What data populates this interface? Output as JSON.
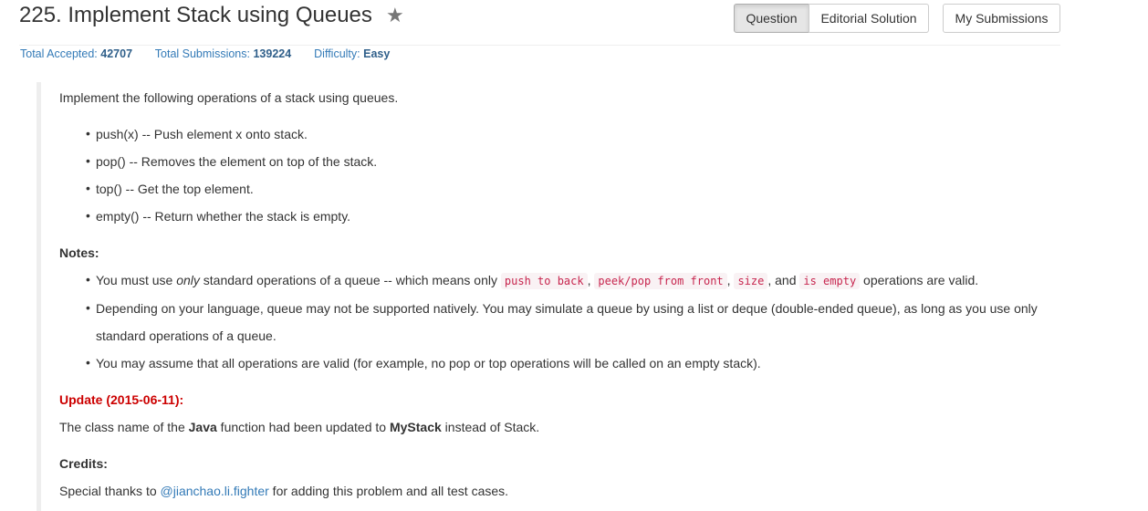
{
  "problem": {
    "title": "225. Implement Stack using Queues",
    "star_icon": "star-icon"
  },
  "tabs": {
    "question": "Question",
    "editorial": "Editorial Solution",
    "submissions": "My Submissions"
  },
  "stats": {
    "accepted_label": "Total Accepted:",
    "accepted_value": "42707",
    "submissions_label": "Total Submissions:",
    "submissions_value": "139224",
    "difficulty_label": "Difficulty:",
    "difficulty_value": "Easy"
  },
  "description": {
    "intro": "Implement the following operations of a stack using queues.",
    "operations": [
      "push(x) -- Push element x onto stack.",
      "pop() -- Removes the element on top of the stack.",
      "top() -- Get the top element.",
      "empty() -- Return whether the stack is empty."
    ],
    "notes_heading": "Notes:",
    "note1": {
      "pre": "You must use ",
      "em": "only",
      "mid": " standard operations of a queue -- which means only ",
      "code1": "push to back",
      "code2": "peek/pop from front",
      "code3": "size",
      "and": ", and ",
      "code4": "is empty",
      "post": " operations are valid."
    },
    "note2_line1": "Depending on your language, queue may not be supported natively. You may simulate a queue by using a list or deque (double-ended queue), as long as you use only",
    "note2_line2": "standard operations of a queue.",
    "note3": "You may assume that all operations are valid (for example, no pop or top operations will be called on an empty stack).",
    "update_heading": "Update (2015-06-11):",
    "update": {
      "pre": "The class name of the ",
      "java": "Java",
      "mid": " function had been updated to ",
      "mystack": "MyStack",
      "post": " instead of Stack."
    },
    "credits_heading": "Credits:",
    "credits": {
      "pre": "Special thanks to ",
      "user": "@jianchao.li.fighter",
      "post": " for adding this problem and all test cases."
    }
  }
}
